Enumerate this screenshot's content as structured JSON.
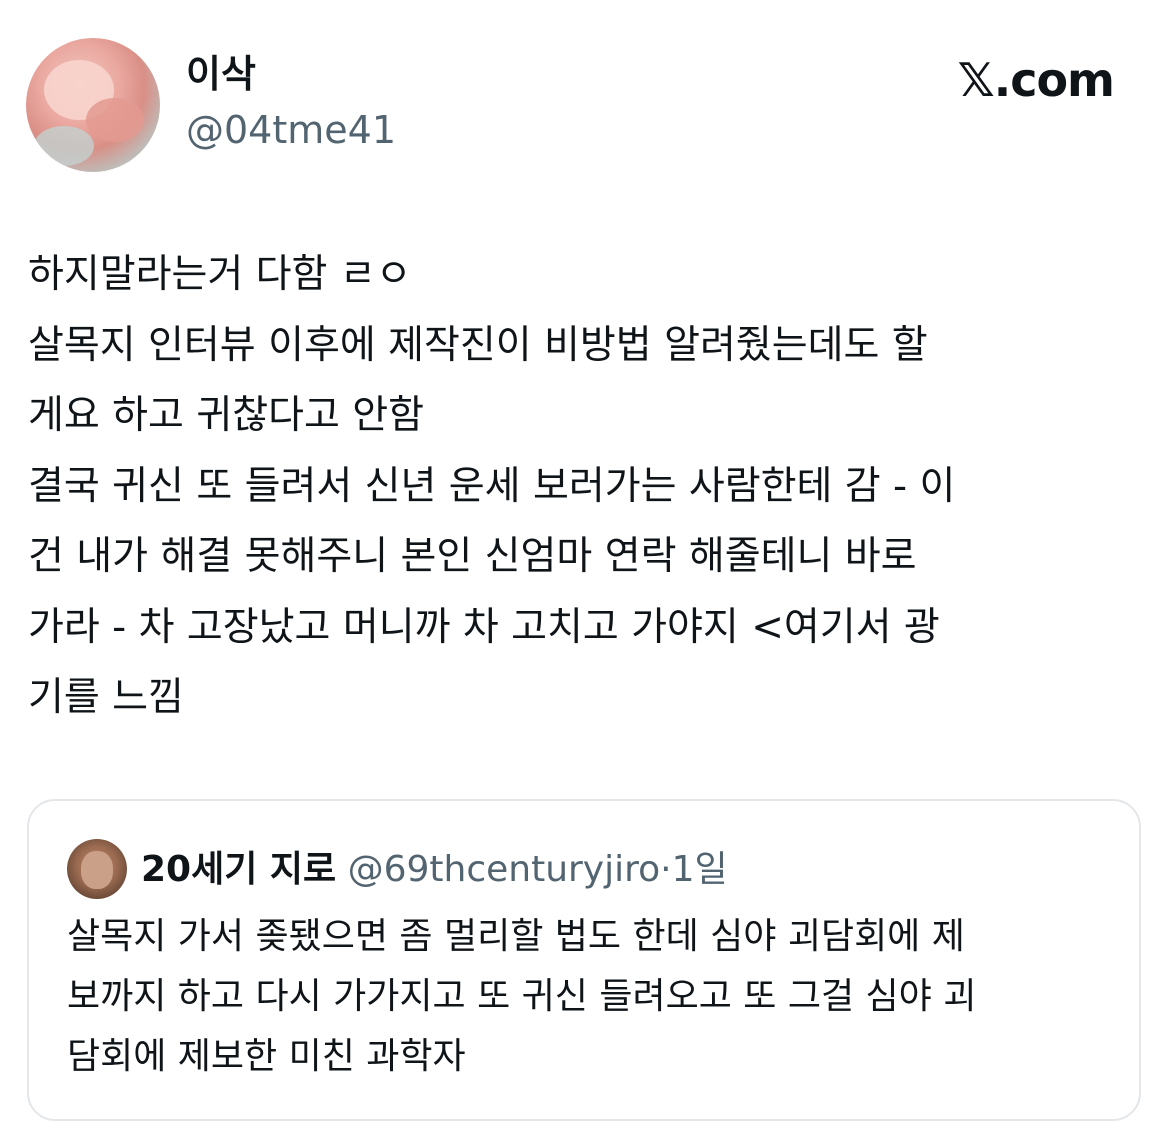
{
  "header": {
    "display_name": "이삭",
    "handle": "@04tme41",
    "brand": "𝕏.com"
  },
  "tweet": {
    "lines": [
      "하지말라는거 다함 ㄹㅇ",
      "살목지 인터뷰 이후에 제작진이 비방법 알려줬는데도 할",
      "게요 하고 귀찮다고 안함",
      "결국 귀신 또 들려서 신년 운세 보러가는 사람한테 감 - 이",
      "건 내가 해결 못해주니 본인 신엄마 연락 해줄테니 바로",
      "가라 - 차 고장났고 머니까 차 고치고 가야지 <여기서 광",
      "기를 느낌"
    ]
  },
  "quote": {
    "display_name": "20세기 지로",
    "handle": "@69thcenturyjiro",
    "separator": "·",
    "time": "1일",
    "lines": [
      "살목지 가서 좆됐으면 좀 멀리할 법도 한데 심야 괴담회에 제",
      "보까지 하고 다시 가가지고 또 귀신 들려오고 또 그걸 심야 괴",
      "담회에 제보한 미친 과학자"
    ]
  }
}
